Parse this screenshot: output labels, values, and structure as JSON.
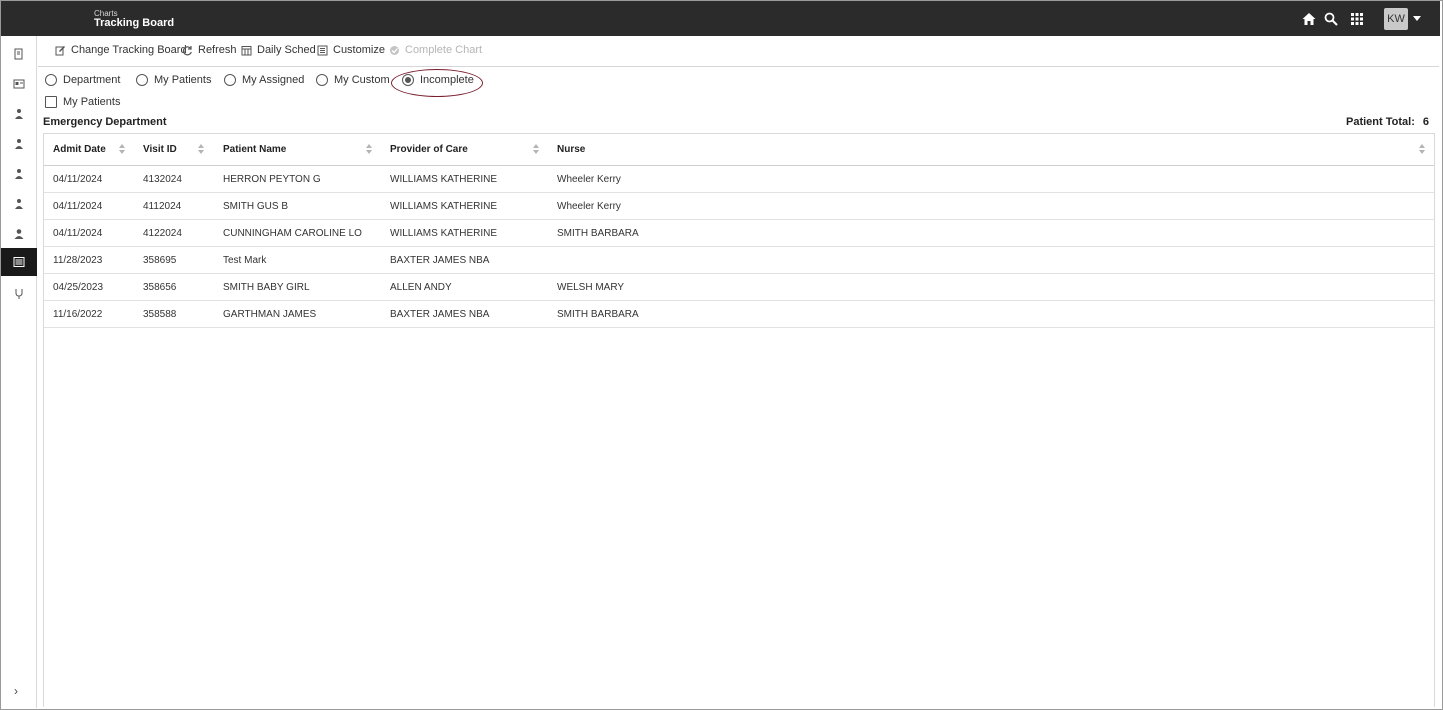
{
  "header": {
    "breadcrumb": "Charts",
    "title": "Tracking Board",
    "user_initials": "KW",
    "icons": [
      "home-icon",
      "search-icon",
      "apps-grid-icon"
    ]
  },
  "toolbar": {
    "change_board": "Change Tracking Board",
    "refresh": "Refresh",
    "daily_sched": "Daily Sched",
    "customize": "Customize",
    "complete_chart": "Complete Chart"
  },
  "filters": {
    "department": "Department",
    "my_patients": "My Patients",
    "my_assigned": "My Assigned",
    "my_custom": "My Custom",
    "incomplete": "Incomplete",
    "selected": "incomplete",
    "my_patients_checkbox": "My Patients"
  },
  "board": {
    "department_label": "Emergency Department",
    "patient_total_label": "Patient Total:",
    "patient_total": "6"
  },
  "table": {
    "columns": {
      "admit_date": "Admit Date",
      "visit_id": "Visit ID",
      "patient_name": "Patient Name",
      "provider": "Provider of Care",
      "nurse": "Nurse"
    },
    "rows": [
      {
        "admit_date": "04/11/2024",
        "visit_id": "4132024",
        "patient_name": "HERRON PEYTON G",
        "provider": "WILLIAMS KATHERINE",
        "nurse": "Wheeler Kerry"
      },
      {
        "admit_date": "04/11/2024",
        "visit_id": "4112024",
        "patient_name": "SMITH GUS B",
        "provider": "WILLIAMS KATHERINE",
        "nurse": "Wheeler Kerry"
      },
      {
        "admit_date": "04/11/2024",
        "visit_id": "4122024",
        "patient_name": "CUNNINGHAM CAROLINE LO",
        "provider": "WILLIAMS KATHERINE",
        "nurse": "SMITH BARBARA"
      },
      {
        "admit_date": "11/28/2023",
        "visit_id": "358695",
        "patient_name": "Test Mark",
        "provider": "BAXTER JAMES NBA",
        "nurse": ""
      },
      {
        "admit_date": "04/25/2023",
        "visit_id": "358656",
        "patient_name": "SMITH BABY GIRL",
        "provider": "ALLEN ANDY",
        "nurse": "WELSH MARY"
      },
      {
        "admit_date": "11/16/2022",
        "visit_id": "358588",
        "patient_name": "GARTHMAN JAMES",
        "provider": "BAXTER JAMES NBA",
        "nurse": "SMITH BARBARA"
      }
    ]
  }
}
